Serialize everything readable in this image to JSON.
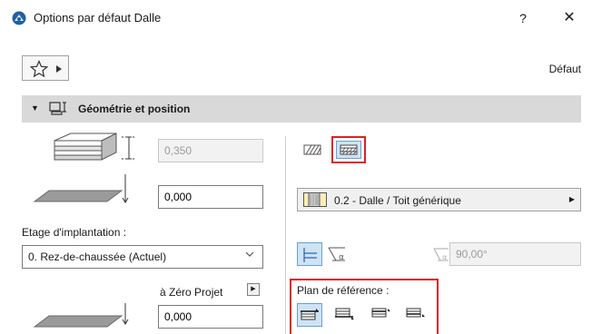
{
  "window": {
    "title": "Options par défaut Dalle",
    "help_label": "?",
    "close_label": "✕"
  },
  "header": {
    "default_label": "Défaut"
  },
  "section": {
    "title": "Géométrie et position"
  },
  "geometry": {
    "thickness_value": "0,350",
    "offset_value": "0,000",
    "story_label": "Etage d'implantation :",
    "story_value": "0. Rez-de-chaussée (Actuel)",
    "zero_label": "à Zéro Projet",
    "bottom_value": "0,000"
  },
  "structure": {
    "material_value": "0.2 - Dalle / Toit générique",
    "angle_value": "90,00°",
    "reference_label": "Plan de référence :"
  },
  "colors": {
    "highlight_red": "#e02020",
    "selected_blue": "#cfe3f6",
    "section_bg": "#d9d9d9"
  }
}
